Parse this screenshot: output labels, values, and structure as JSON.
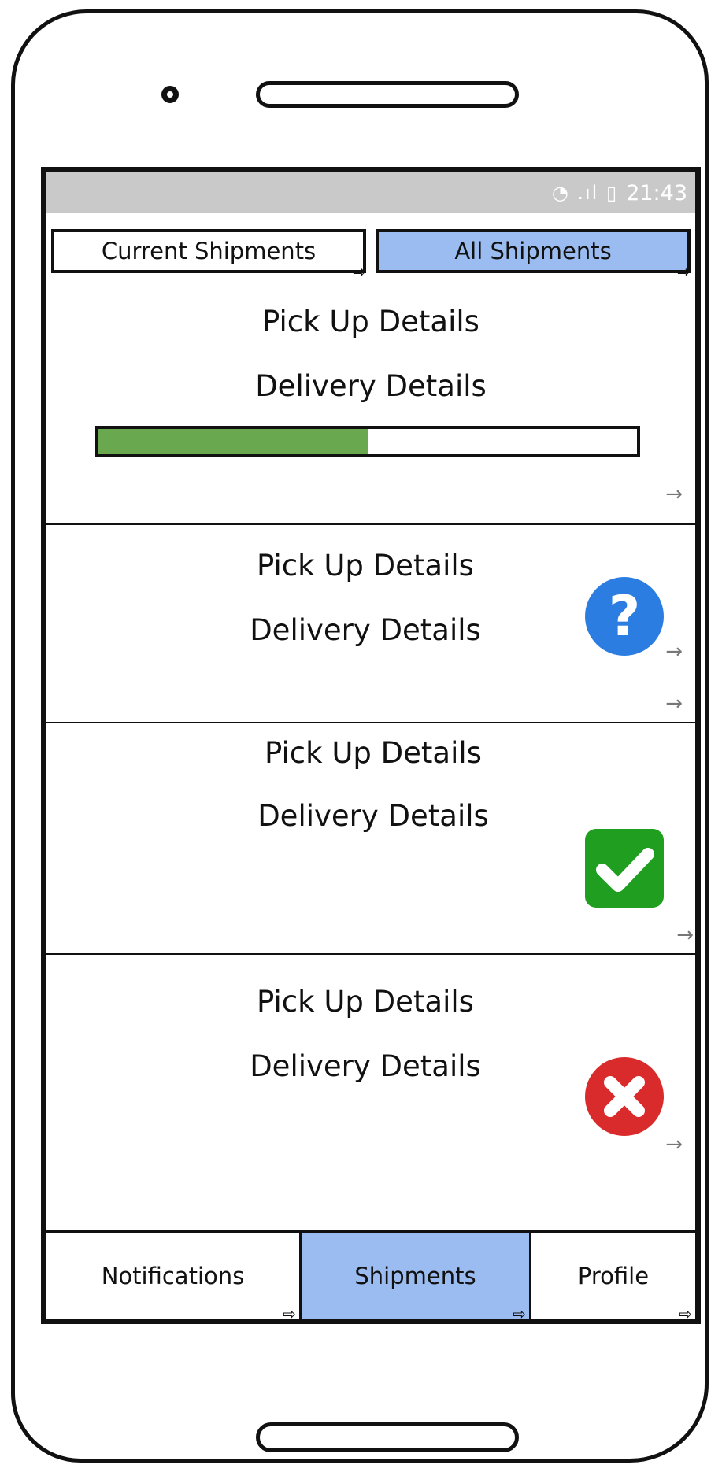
{
  "status_bar": {
    "icons": "signal-wifi-battery",
    "time": "21:43"
  },
  "tabs": [
    {
      "label": "Current Shipments",
      "active": false
    },
    {
      "label": "All Shipments",
      "active": true
    }
  ],
  "shipments": [
    {
      "pickup": "Pick Up Details",
      "delivery": "Delivery Details",
      "status": "in-progress",
      "progress": 0.5
    },
    {
      "pickup": "Pick Up Details",
      "delivery": "Delivery Details",
      "status": "unknown",
      "icon": "question-icon"
    },
    {
      "pickup": "Pick Up Details",
      "delivery": "Delivery Details",
      "status": "delivered",
      "icon": "check-icon"
    },
    {
      "pickup": "Pick Up Details",
      "delivery": "Delivery Details",
      "status": "failed",
      "icon": "cross-icon"
    }
  ],
  "bottom_nav": [
    {
      "label": "Notifications",
      "active": false
    },
    {
      "label": "Shipments",
      "active": true
    },
    {
      "label": "Profile",
      "active": false
    }
  ],
  "colors": {
    "active_tab": "#9bbcf1",
    "progress_fill": "#6aa84f",
    "question": "#2b7de1",
    "check": "#1f9e1f",
    "cross": "#d92b2b",
    "status_bar": "#c9c9c9"
  }
}
